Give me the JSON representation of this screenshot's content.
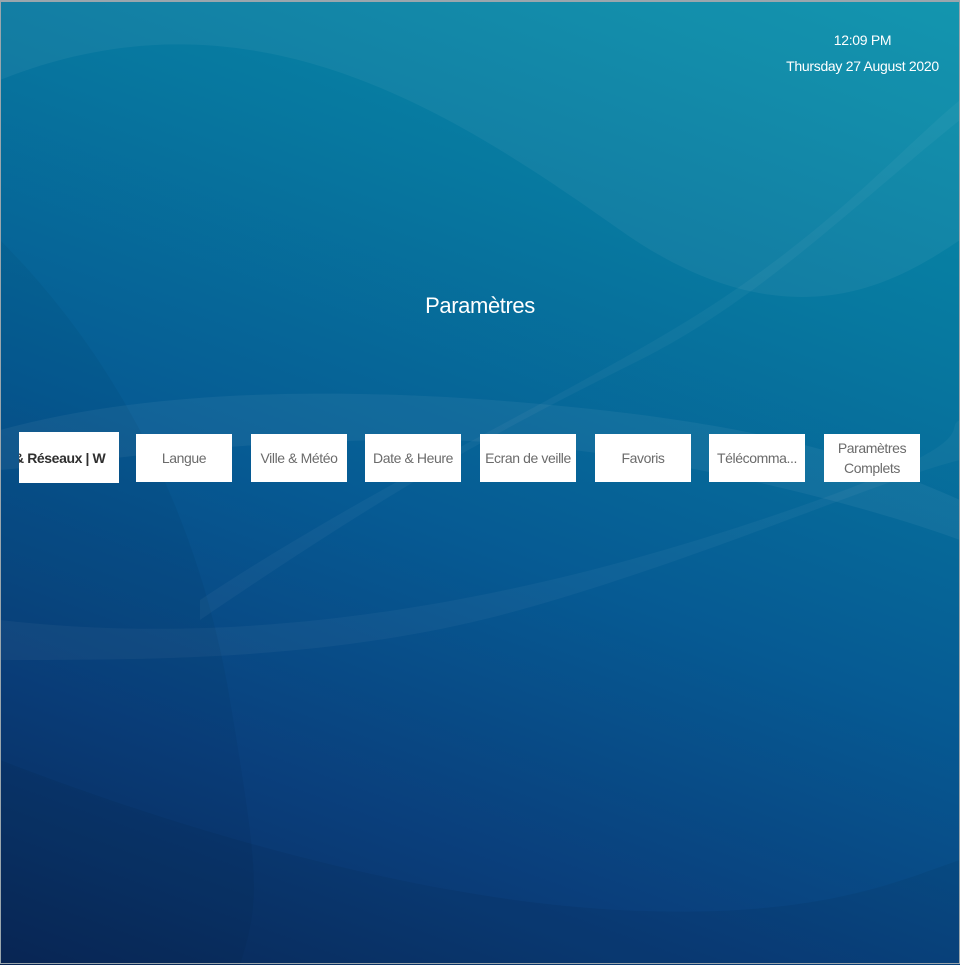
{
  "clock": {
    "time": "12:09 PM",
    "date": "Thursday 27 August 2020"
  },
  "page": {
    "title": "Paramètres"
  },
  "tiles": [
    {
      "label": "& Réseaux | W",
      "focused": true
    },
    {
      "label": "Langue"
    },
    {
      "label": "Ville & Météo"
    },
    {
      "label": "Date & Heure"
    },
    {
      "label": "Ecran de veille"
    },
    {
      "label": "Favoris"
    },
    {
      "label": "Télécomma..."
    },
    {
      "label": "Paramètres Complets"
    }
  ],
  "colors": {
    "background_top": "#0791ab",
    "background_bottom": "#0a2a5c",
    "tile_background": "#ffffff",
    "tile_text": "#6b6b6b",
    "focused_text": "#2f2f2f"
  }
}
